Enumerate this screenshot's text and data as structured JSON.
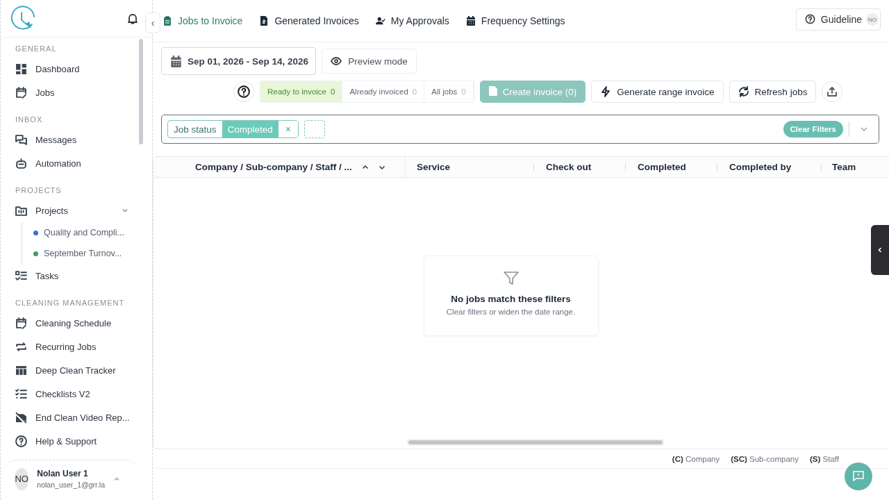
{
  "sidebar": {
    "collapse_glyph": "‹",
    "sections": [
      {
        "title": "GENERAL",
        "items": [
          {
            "label": "Dashboard"
          },
          {
            "label": "Jobs"
          }
        ]
      },
      {
        "title": "INBOX",
        "items": [
          {
            "label": "Messages"
          },
          {
            "label": "Automation"
          }
        ]
      },
      {
        "title": "PROJECTS",
        "items": [
          {
            "label": "Projects",
            "expanded": true,
            "children": [
              {
                "label": "Quality and Compli...",
                "color": "#3b6fd1"
              },
              {
                "label": "September Turnov...",
                "color": "#3f9e63"
              }
            ]
          },
          {
            "label": "Tasks"
          }
        ]
      },
      {
        "title": "CLEANING MANAGEMENT",
        "items": [
          {
            "label": "Cleaning Schedule"
          },
          {
            "label": "Recurring Jobs"
          },
          {
            "label": "Deep Clean Tracker"
          },
          {
            "label": "Checklists V2"
          },
          {
            "label": "End Clean Video Rep..."
          },
          {
            "label": "Help & Support"
          }
        ]
      }
    ],
    "user": {
      "initials": "NO",
      "name": "Nolan User 1",
      "email": "nolan_user_1@grr.la"
    }
  },
  "tabs": [
    {
      "label": "Jobs to Invoice",
      "selected": true
    },
    {
      "label": "Generated Invoices",
      "selected": false
    },
    {
      "label": "My Approvals",
      "selected": false
    },
    {
      "label": "Frequency Settings",
      "selected": false
    }
  ],
  "guideline": {
    "label": "Guideline",
    "badge": "NO"
  },
  "date_range": "Sep 01, 2026 - Sep 14, 2026",
  "preview_button": "Preview mode",
  "status_filters": [
    {
      "label": "Ready to invoice",
      "count": "0",
      "selected": true
    },
    {
      "label": "Already invoiced",
      "count": "0",
      "selected": false
    },
    {
      "label": "All jobs",
      "count": "0",
      "selected": false
    }
  ],
  "actions": [
    {
      "kind": "create",
      "label": "Create invoice (0)",
      "disabled": true
    },
    {
      "kind": "generate",
      "label": "Generate range invoice",
      "disabled": false
    },
    {
      "kind": "refresh",
      "label": "Refresh jobs",
      "disabled": false
    }
  ],
  "filter_bar": {
    "chips": [
      {
        "field": "Job status",
        "value": "Completed",
        "remove": "×"
      }
    ],
    "clear_button": "Clear Filters"
  },
  "table": {
    "columns": [
      {
        "label": "Company / Sub-company / Staff / ...",
        "sortable": true
      },
      {
        "label": "Service",
        "sortable": false
      },
      {
        "label": "Check out",
        "sortable": false
      },
      {
        "label": "Completed",
        "sortable": false
      },
      {
        "label": "Completed by",
        "sortable": false
      },
      {
        "label": "Team",
        "sortable": false
      }
    ],
    "empty_state": {
      "title": "No jobs match these filters",
      "message": "Clear filters or widen the date range."
    }
  },
  "legend": [
    {
      "abbr": "(C)",
      "label": "Company"
    },
    {
      "abbr": "(SC)",
      "label": "Sub-company"
    },
    {
      "abbr": "(S)",
      "label": "Staff"
    }
  ]
}
